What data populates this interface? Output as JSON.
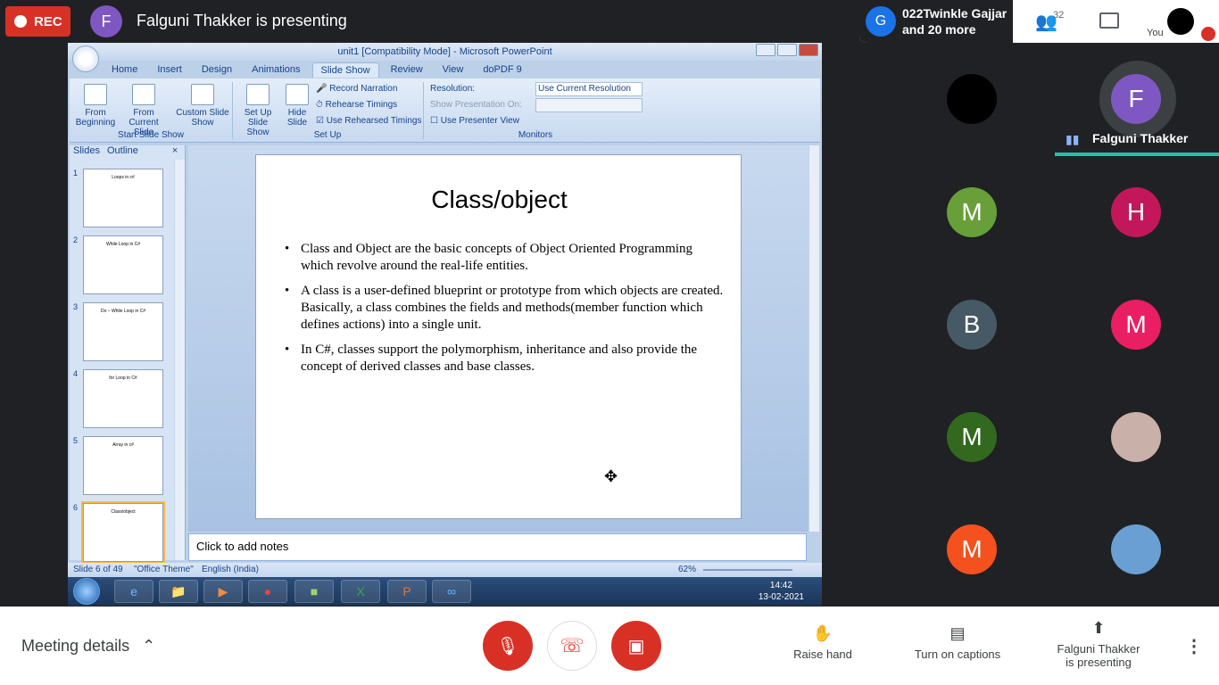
{
  "top_bar": {
    "rec_label": "REC",
    "presenter_initial": "F",
    "presenting_title": "Falguni Thakker is presenting",
    "speaker_initial": "G",
    "speaker_name_line1": "022Twinkle Gajjar",
    "speaker_name_line2": "and 20 more",
    "people_count": "32",
    "you_label": "You"
  },
  "powerpoint": {
    "window_title": "unit1 [Compatibility Mode] - Microsoft PowerPoint",
    "tabs": [
      "Home",
      "Insert",
      "Design",
      "Animations",
      "Slide Show",
      "Review",
      "View",
      "doPDF 9"
    ],
    "active_tab": "Slide Show",
    "ribbon": {
      "from_beginning": "From Beginning",
      "from_current": "From Current Slide",
      "custom_show": "Custom Slide Show",
      "group_start": "Start Slide Show",
      "setup_show": "Set Up Slide Show",
      "hide_slide": "Hide Slide",
      "record_narration": "Record Narration",
      "rehearse_timings": "Rehearse Timings",
      "use_rehearsed": "Use Rehearsed Timings",
      "group_setup": "Set Up",
      "resolution_label": "Resolution:",
      "resolution_value": "Use Current Resolution",
      "show_on_label": "Show Presentation On:",
      "presenter_view": "Use Presenter View",
      "group_monitors": "Monitors"
    },
    "pane_tabs": [
      "Slides",
      "Outline"
    ],
    "thumbnails": [
      {
        "num": "1",
        "title": "Loops in c#"
      },
      {
        "num": "2",
        "title": "While Loop in C#"
      },
      {
        "num": "3",
        "title": "Do – While Loop in C#"
      },
      {
        "num": "4",
        "title": "for Loop in C#"
      },
      {
        "num": "5",
        "title": "Array in c#"
      },
      {
        "num": "6",
        "title": "Class/object"
      }
    ],
    "slide": {
      "title": "Class/object",
      "bullets": [
        "Class and Object are the basic concepts of Object Oriented Programming which revolve around the real-life entities.",
        "A class is a user-defined blueprint or prototype from which objects are created. Basically, a class combines the fields and methods(member function which defines actions) into a single unit.",
        "In C#, classes support the polymorphism, inheritance and also provide the concept of derived classes and base classes."
      ]
    },
    "notes_placeholder": "Click to add notes",
    "status": {
      "slide_info": "Slide 6 of 49",
      "theme": "\"Office Theme\"",
      "language": "English (India)",
      "zoom": "62%"
    },
    "taskbar": {
      "time": "14:42",
      "date": "13-02-2021"
    }
  },
  "participants": {
    "presenter_name": "Falguni Thakker",
    "tiles": [
      {
        "initial": "",
        "color": "#000000"
      },
      {
        "initial": "F",
        "color": "#7e57c2"
      },
      {
        "initial": "M",
        "color": "#689f38"
      },
      {
        "initial": "H",
        "color": "#c2185b"
      },
      {
        "initial": "B",
        "color": "#455a64"
      },
      {
        "initial": "M",
        "color": "#e91e63"
      },
      {
        "initial": "M",
        "color": "#33691e"
      },
      {
        "initial": "",
        "color": "#c9b0a8"
      },
      {
        "initial": "M",
        "color": "#f4511e"
      },
      {
        "initial": "",
        "color": "#6a9fd4"
      }
    ]
  },
  "bottom_bar": {
    "meeting_details": "Meeting details",
    "raise_hand": "Raise hand",
    "captions": "Turn on captions",
    "presenting_line1": "Falguni Thakker",
    "presenting_line2": "is presenting"
  }
}
